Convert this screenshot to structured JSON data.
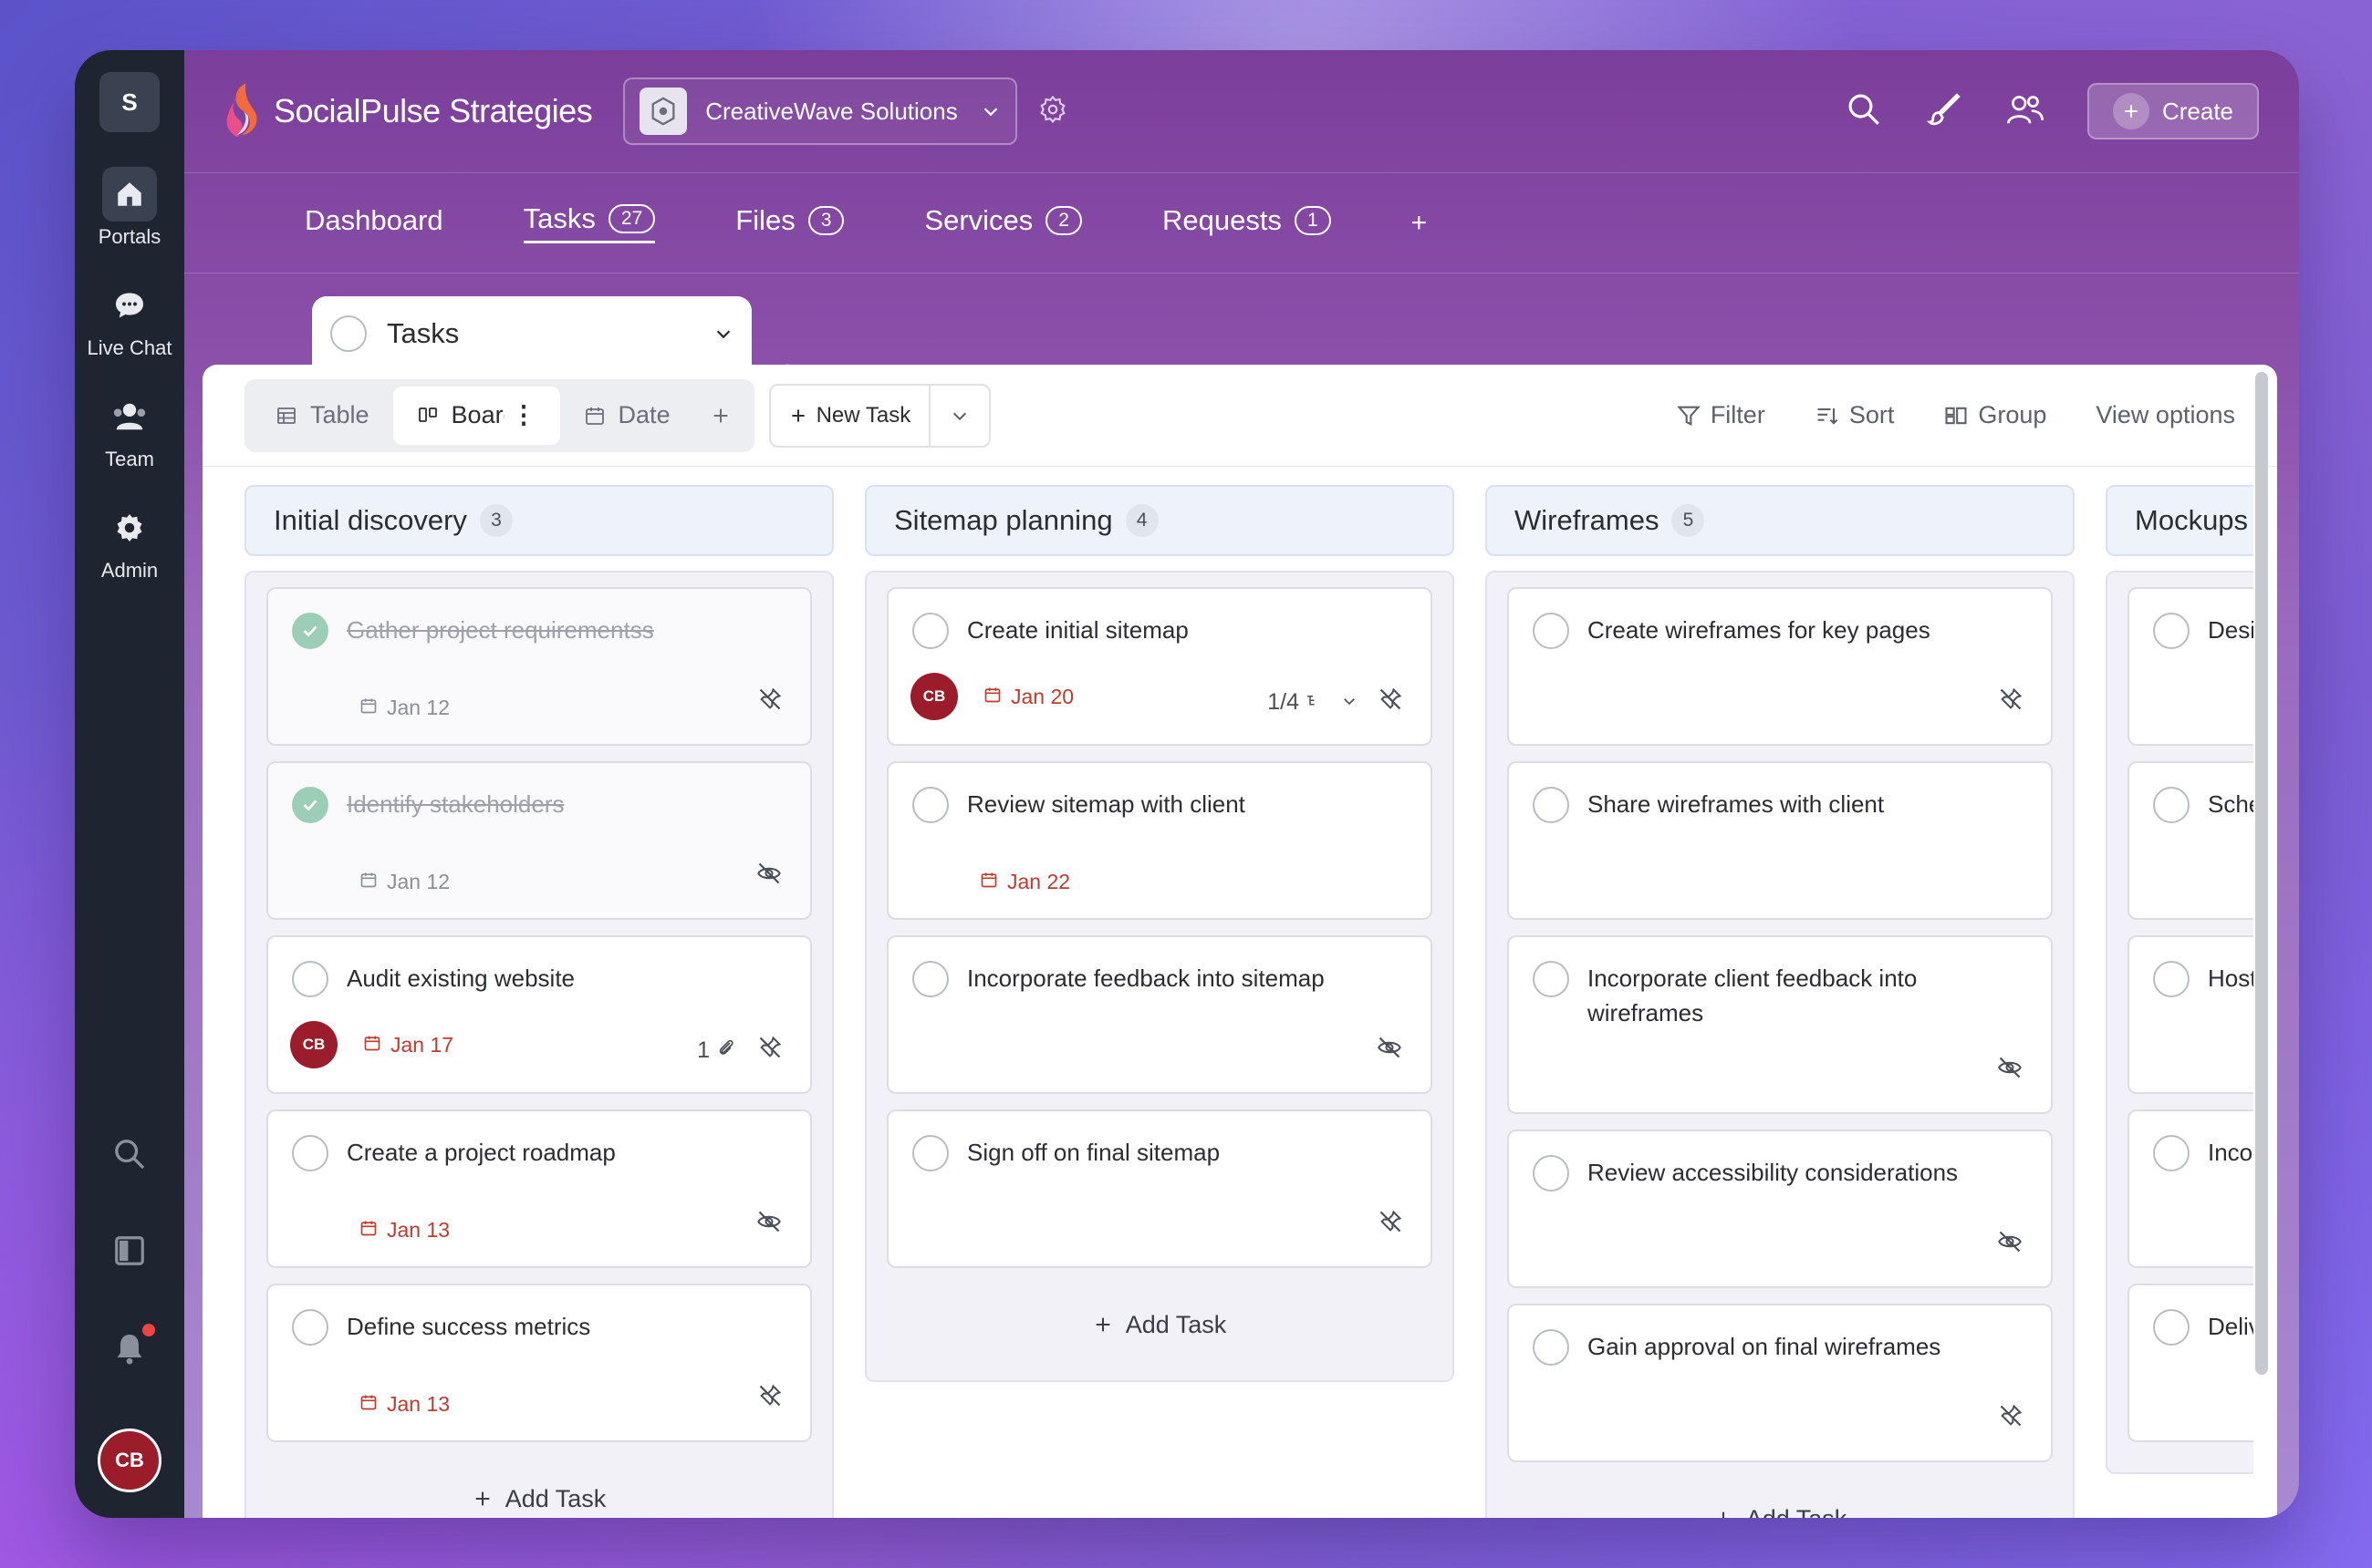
{
  "rail": {
    "workspace_letter": "S",
    "items": [
      {
        "label": "Portals",
        "icon": "home-icon"
      },
      {
        "label": "Live Chat",
        "icon": "chat-icon"
      },
      {
        "label": "Team",
        "icon": "team-icon"
      },
      {
        "label": "Admin",
        "icon": "gear-icon"
      }
    ],
    "avatar_initials": "CB"
  },
  "header": {
    "brand": "SocialPulse Strategies",
    "workspace": "CreativeWave Solutions",
    "create_label": "Create"
  },
  "nav": {
    "tabs": [
      {
        "label": "Dashboard",
        "count": ""
      },
      {
        "label": "Tasks",
        "count": "27"
      },
      {
        "label": "Files",
        "count": "3"
      },
      {
        "label": "Services",
        "count": "2"
      },
      {
        "label": "Requests",
        "count": "1"
      }
    ],
    "add": "+"
  },
  "view": {
    "name": "Tasks",
    "modes": [
      "Table",
      "Board",
      "Date"
    ],
    "new_task": "New Task",
    "filter": "Filter",
    "sort": "Sort",
    "group": "Group",
    "view_options": "View options",
    "add_task": "Add Task"
  },
  "columns": [
    {
      "title": "Initial discovery",
      "count": "3",
      "cards": [
        {
          "title": "Gather project requirementss",
          "date": "Jan 12",
          "done": true,
          "avatar": "",
          "extra": "",
          "icon": "unpin-icon"
        },
        {
          "title": "Identify stakeholders",
          "date": "Jan 12",
          "done": true,
          "avatar": "",
          "extra": "",
          "icon": "eye-off-icon"
        },
        {
          "title": "Audit existing website",
          "date": "Jan 17",
          "done": false,
          "avatar": "CB",
          "extra": "1",
          "icon": "unpin-icon"
        },
        {
          "title": "Create a project roadmap",
          "date": "Jan 13",
          "done": false,
          "avatar": "",
          "extra": "",
          "icon": "eye-off-icon"
        },
        {
          "title": "Define success metrics",
          "date": "Jan 13",
          "done": false,
          "avatar": "",
          "extra": "",
          "icon": "unpin-icon"
        }
      ]
    },
    {
      "title": "Sitemap planning",
      "count": "4",
      "cards": [
        {
          "title": "Create initial sitemap",
          "date": "Jan 20",
          "done": false,
          "avatar": "CB",
          "extra": "1/4",
          "icon": "unpin-icon"
        },
        {
          "title": "Review sitemap with client",
          "date": "Jan 22",
          "done": false,
          "avatar": "",
          "extra": "",
          "icon": ""
        },
        {
          "title": "Incorporate feedback into sitemap",
          "date": "",
          "done": false,
          "avatar": "",
          "extra": "",
          "icon": "eye-off-icon"
        },
        {
          "title": "Sign off on final sitemap",
          "date": "",
          "done": false,
          "avatar": "",
          "extra": "",
          "icon": "unpin-icon"
        }
      ]
    },
    {
      "title": "Wireframes",
      "count": "5",
      "cards": [
        {
          "title": "Create wireframes for key pages",
          "date": "",
          "done": false,
          "avatar": "",
          "extra": "",
          "icon": "unpin-icon"
        },
        {
          "title": "Share wireframes with client",
          "date": "",
          "done": false,
          "avatar": "",
          "extra": "",
          "icon": ""
        },
        {
          "title": "Incorporate client feedback into wireframes",
          "date": "",
          "done": false,
          "avatar": "",
          "extra": "",
          "icon": "eye-off-icon"
        },
        {
          "title": "Review accessibility considerations",
          "date": "",
          "done": false,
          "avatar": "",
          "extra": "",
          "icon": "eye-off-icon"
        },
        {
          "title": "Gain approval on final wireframes",
          "date": "",
          "done": false,
          "avatar": "",
          "extra": "",
          "icon": "unpin-icon"
        }
      ]
    },
    {
      "title": "Mockups",
      "count": "",
      "cards": [
        {
          "title": "Desig",
          "date": "",
          "done": false,
          "avatar": "",
          "extra": "",
          "icon": ""
        },
        {
          "title": "Schec",
          "date": "",
          "done": false,
          "avatar": "",
          "extra": "",
          "icon": ""
        },
        {
          "title": "Host",
          "date": "",
          "done": false,
          "avatar": "",
          "extra": "",
          "icon": ""
        },
        {
          "title": "Incor",
          "date": "",
          "done": false,
          "avatar": "",
          "extra": "",
          "icon": ""
        },
        {
          "title": "Deliv",
          "date": "",
          "done": false,
          "avatar": "",
          "extra": "",
          "icon": ""
        }
      ]
    }
  ]
}
